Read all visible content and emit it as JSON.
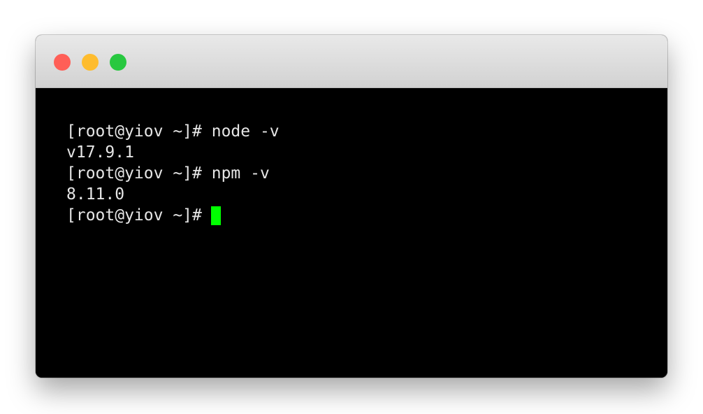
{
  "window": {
    "traffic_lights": {
      "close_color": "#ff5f57",
      "minimize_color": "#febc2e",
      "zoom_color": "#28c840"
    }
  },
  "terminal": {
    "lines": [
      {
        "prompt": "[root@yiov ~]#",
        "command": " node -v"
      },
      {
        "output": "v17.9.1"
      },
      {
        "prompt": "[root@yiov ~]#",
        "command": " npm -v"
      },
      {
        "output": "8.11.0"
      },
      {
        "prompt": "[root@yiov ~]#",
        "command": ""
      }
    ],
    "cursor_color": "#00ff00",
    "text_color": "#e6e6e6",
    "background_color": "#000000"
  }
}
